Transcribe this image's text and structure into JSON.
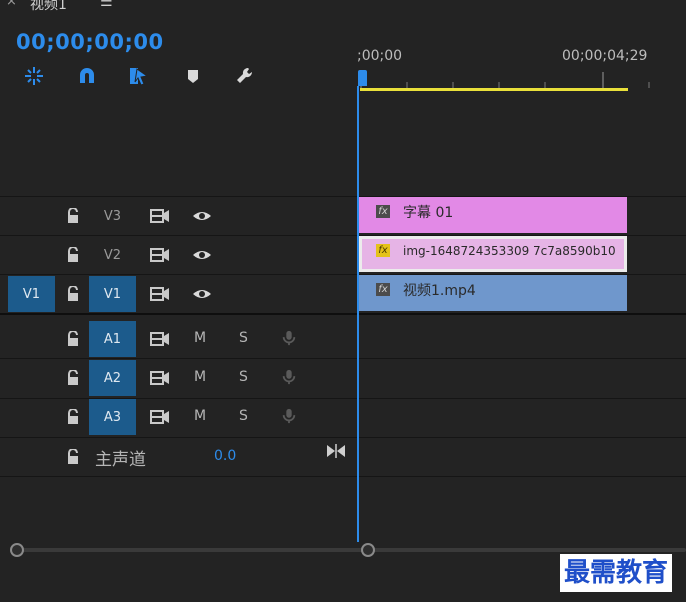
{
  "panel": {
    "close_glyph": "×",
    "sequence_name": "视频1",
    "menu_glyph": "☰"
  },
  "timecode": "00;00;00;00",
  "toolbar": [
    {
      "name": "insert-nest-icon"
    },
    {
      "name": "snap-magnet-icon"
    },
    {
      "name": "linked-selection-icon"
    },
    {
      "name": "add-marker-icon"
    },
    {
      "name": "timeline-settings-wrench-icon"
    }
  ],
  "ruler": {
    "start_label": ";00;00",
    "end_label": "00;00;04;29"
  },
  "tracks": {
    "video": [
      {
        "source_patch": "",
        "label": "V3"
      },
      {
        "source_patch": "",
        "label": "V2"
      },
      {
        "source_patch": "V1",
        "label": "V1"
      }
    ],
    "audio": [
      {
        "label": "A1",
        "mute": "M",
        "solo": "S"
      },
      {
        "label": "A2",
        "mute": "M",
        "solo": "S"
      },
      {
        "label": "A3",
        "mute": "M",
        "solo": "S"
      }
    ],
    "master": {
      "label": "主声道",
      "value": "0.0"
    }
  },
  "clips": [
    {
      "track": "V3",
      "name": "字幕 01",
      "fx": "fx",
      "color": "#e289e6"
    },
    {
      "track": "V2",
      "name": "img-1648724353309 7c7a8590b10",
      "fx": "fx",
      "color": "#e6b4e6"
    },
    {
      "track": "V1",
      "name": "视频1.mp4",
      "fx": "fx",
      "color": "#6f97cc"
    }
  ],
  "watermark": "最需教育"
}
